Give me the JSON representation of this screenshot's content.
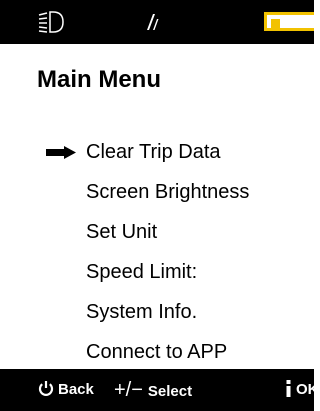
{
  "status_bar": {
    "headlight_icon": "headlight-icon",
    "assist_icon": "assist-level-icon",
    "battery_icon": "battery-icon",
    "battery_level": 0.22,
    "battery_color": "#f2c200"
  },
  "menu": {
    "title": "Main Menu",
    "selected_index": 0,
    "items": [
      {
        "label": "Clear Trip Data"
      },
      {
        "label": "Screen Brightness"
      },
      {
        "label": "Set Unit"
      },
      {
        "label": "Speed Limit:"
      },
      {
        "label": "System Info."
      },
      {
        "label": "Connect to APP"
      }
    ]
  },
  "hint_bar": {
    "back_label": "Back",
    "back_icon": "power-icon",
    "select_symbol": "+/−",
    "select_label": "Select",
    "ok_icon": "info-icon",
    "ok_label": "OK"
  }
}
